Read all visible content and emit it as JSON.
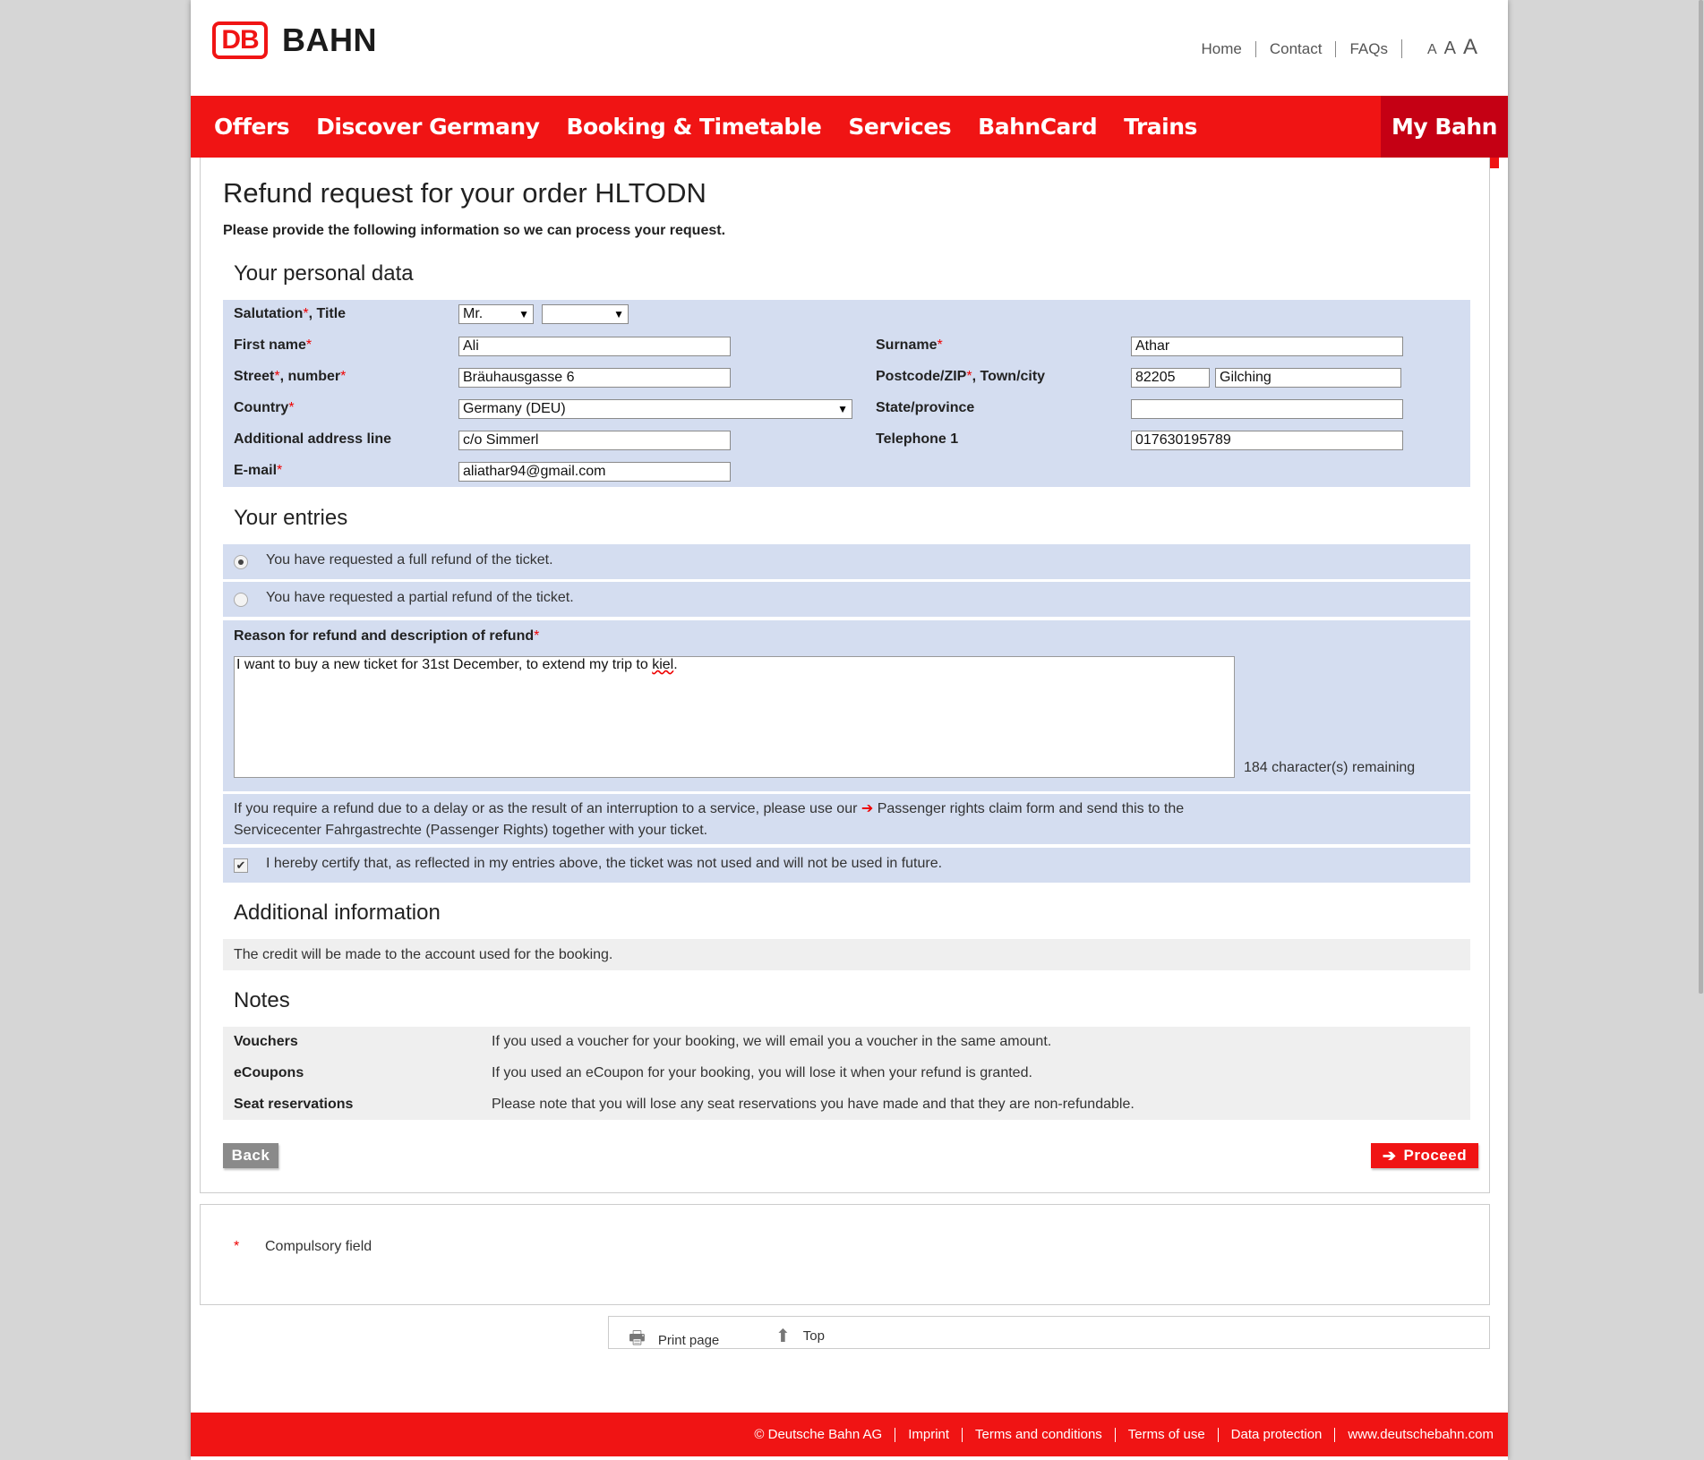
{
  "header": {
    "logo_mark": "DB",
    "logo_text": "BAHN",
    "meta_links": [
      "Home",
      "Contact",
      "FAQs"
    ],
    "font_sizes": [
      "A",
      "A",
      "A"
    ]
  },
  "nav": {
    "items": [
      "Offers",
      "Discover Germany",
      "Booking & Timetable",
      "Services",
      "BahnCard",
      "Trains"
    ],
    "my_bahn": "My Bahn"
  },
  "page": {
    "title": "Refund request for your order HLTODN",
    "intro": "Please provide the following information so we can process your request."
  },
  "personal": {
    "heading": "Your personal data",
    "salutation_label": "Salutation",
    "title_label": ", Title",
    "salutation_value": "Mr.",
    "title_value": "",
    "first_name_label": "First name",
    "first_name": "Ali",
    "surname_label": "Surname",
    "surname": "Athar",
    "street_label": "Street",
    "number_label": ", number",
    "street": "Bräuhausgasse 6",
    "postcode_label": "Postcode/ZIP",
    "town_label": ", Town/city",
    "postcode": "82205",
    "town": "Gilching",
    "country_label": "Country",
    "country": "Germany (DEU)",
    "state_label": "State/province",
    "state": "",
    "addl_label": "Additional address line",
    "addl": "c/o Simmerl",
    "phone_label": "Telephone 1",
    "phone": "017630195789",
    "email_label": "E-mail",
    "email": "aliathar94@gmail.com",
    "required_mark": "*"
  },
  "entries": {
    "heading": "Your entries",
    "option_full": "You have requested a full refund of the ticket.",
    "option_partial": "You have requested a partial refund of the ticket.",
    "selected": "full",
    "reason_label": "Reason for refund and description of refund",
    "reason_text_before": "I want to buy a new ticket for 31st December, to extend my trip to ",
    "reason_text_misspelled": "kiel",
    "reason_text_after": ".",
    "remaining": "184 character(s) remaining",
    "info_line1_before": "If you require a refund due to a delay or as the result of an interruption to a service, please use our ",
    "info_line1_link": "Passenger rights claim form",
    "info_line1_after": " and send this to the",
    "info_line2": "Servicecenter Fahrgastrechte (Passenger Rights) together with your ticket.",
    "certify": "I hereby certify that, as reflected in my entries above, the ticket was not used and will not be used in future.",
    "certify_checked": true
  },
  "additional": {
    "heading": "Additional information",
    "text": "The credit will be made to the account used for the booking."
  },
  "notes": {
    "heading": "Notes",
    "rows": [
      {
        "label": "Vouchers",
        "text": "If you used a voucher for your booking, we will email you a voucher in the same amount."
      },
      {
        "label": "eCoupons",
        "text": "If you used an eCoupon for your booking, you will lose it when your refund is granted."
      },
      {
        "label": "Seat reservations",
        "text": "Please note that you will lose any seat reservations you have made and that they are non-refundable."
      }
    ]
  },
  "buttons": {
    "back": "Back",
    "proceed": "Proceed"
  },
  "legend": {
    "star": "*",
    "text": "Compulsory field"
  },
  "tools": {
    "print": "Print page",
    "top": "Top"
  },
  "footer": {
    "links": [
      "© Deutsche Bahn AG",
      "Imprint",
      "Terms and conditions",
      "Terms of use",
      "Data protection",
      "www.deutschebahn.com"
    ]
  },
  "colors": {
    "brand_red": "#f01414",
    "panel_blue": "#d4ddf0",
    "my_bahn_red": "#c50014"
  }
}
